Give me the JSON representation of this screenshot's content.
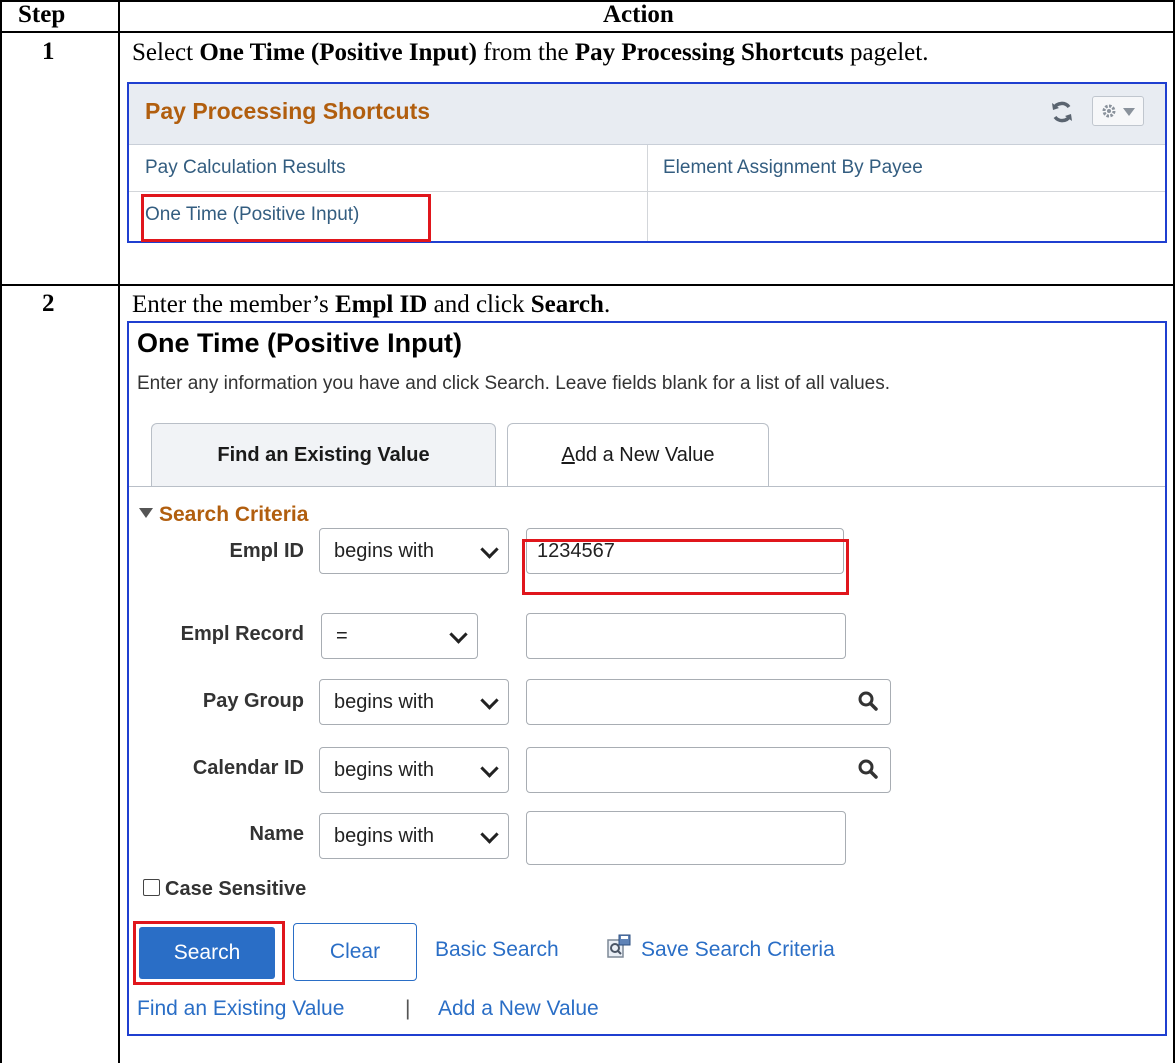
{
  "table": {
    "header_step": "Step",
    "header_action": "Action",
    "step1_num": "1",
    "step2_num": "2",
    "step1_instruction": {
      "t1": "Select ",
      "b1": "One Time (Positive Input)",
      "t2": " from the ",
      "b2": "Pay Processing Shortcuts",
      "t3": " pagelet."
    },
    "step2_instruction": {
      "t1": "Enter the member’s ",
      "b1": "Empl ID",
      "t2": " and click ",
      "b2": "Search",
      "t3": "."
    }
  },
  "pagelet": {
    "title": "Pay Processing Shortcuts",
    "links": [
      "Pay Calculation Results",
      "Element Assignment By Payee",
      "One Time (Positive Input)"
    ],
    "icons": [
      "refresh-icon",
      "gear-icon",
      "caret-down-icon"
    ]
  },
  "search_page": {
    "title": "One Time (Positive Input)",
    "description": "Enter any information you have and click Search. Leave fields blank for a list of all values.",
    "tabs": {
      "find_existing": "Find an Existing Value",
      "add_new_first": "A",
      "add_new_rest": "dd a New Value"
    },
    "criteria_title": "Search Criteria",
    "fields": [
      {
        "label": "Empl ID",
        "operator": "begins with",
        "value": "1234567"
      },
      {
        "label": "Empl Record",
        "operator": "=",
        "value": ""
      },
      {
        "label": "Pay Group",
        "operator": "begins with",
        "value": ""
      },
      {
        "label": "Calendar ID",
        "operator": "begins with",
        "value": ""
      },
      {
        "label": "Name",
        "operator": "begins with",
        "value": ""
      }
    ],
    "case_sensitive_label": "Case Sensitive",
    "case_sensitive_checked": false,
    "buttons": {
      "search": "Search",
      "clear": "Clear",
      "basic_search": "Basic Search",
      "save_criteria": "Save Search Criteria"
    },
    "bottom_links": {
      "find_existing": "Find an Existing Value",
      "separator": "|",
      "add_new": "Add a New Value"
    }
  },
  "colors": {
    "highlight": "#e0161c",
    "frame": "#1f3fd0",
    "link": "#2a6ec6",
    "heading_orange": "#b15e0e"
  }
}
